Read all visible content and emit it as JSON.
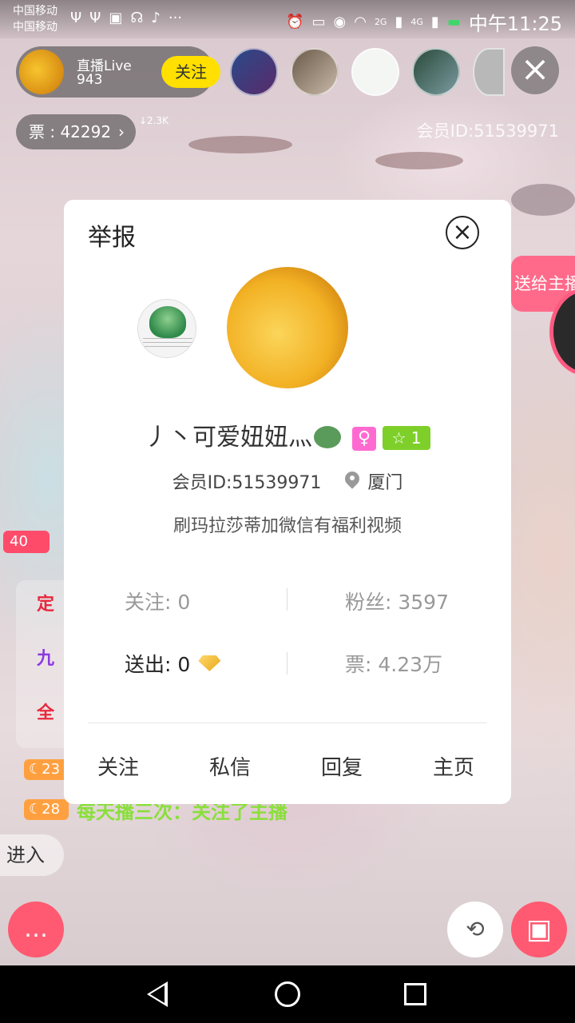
{
  "status_bar": {
    "carrier_1": "中国移动",
    "carrier_2": "中国移动",
    "time": "中午11:25",
    "network_2g": "2G",
    "network_4g": "4G"
  },
  "anchor": {
    "name": "直播Live",
    "count": "943",
    "follow_label": "关注"
  },
  "tickets": {
    "label": "票 : 42292",
    "delta": "↓2.3K"
  },
  "member_id_top": "会员ID:51539971",
  "gift_ribbon_text": "送给主播",
  "chat": {
    "level_badge": "40",
    "lines": [
      "定",
      "九",
      "全"
    ],
    "moon_badges": [
      "23",
      "28"
    ],
    "bottom_line": "每天播三次：关注了主播",
    "enter_label": "进入"
  },
  "dialog": {
    "report_label": "举报",
    "nickname": "丿丶可爱妞妞灬",
    "gender_symbol": "♀",
    "level_star": "☆",
    "level_value": "1",
    "member_id": "会员ID:51539971",
    "location": "厦门",
    "signature": "刷玛拉莎蒂加微信有福利视频",
    "stats": {
      "following": "关注: 0",
      "fans": "粉丝: 3597",
      "sent": "送出: 0",
      "tickets": "票: 4.23万"
    },
    "actions": {
      "follow": "关注",
      "message": "私信",
      "reply": "回复",
      "homepage": "主页"
    }
  },
  "colors": {
    "accent_pink": "#ff5a72",
    "follow_yellow": "#ffe000",
    "level_green": "#7ecf2a",
    "gender_pink": "#ff6ad1"
  }
}
